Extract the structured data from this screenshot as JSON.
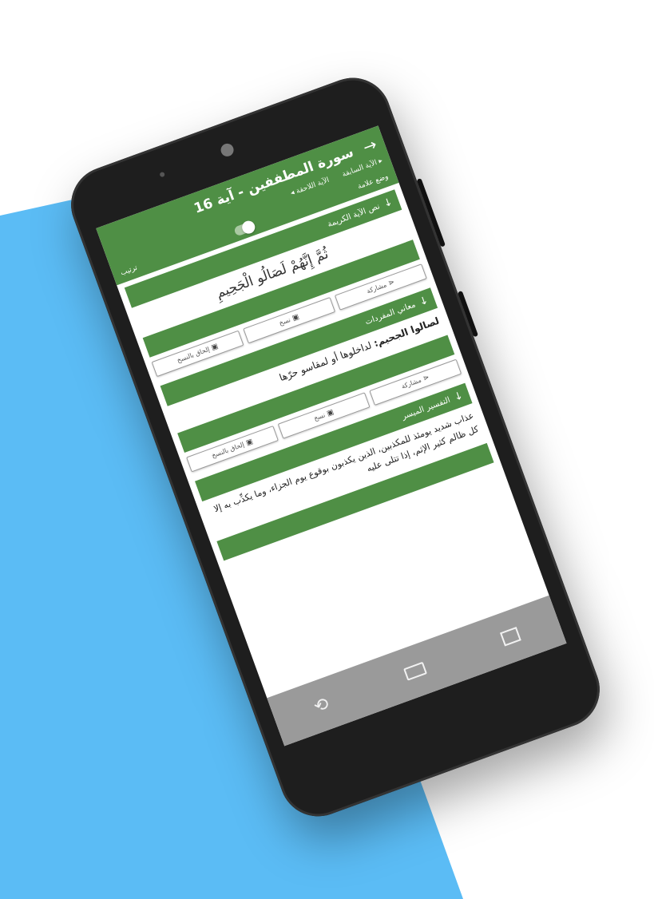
{
  "header": {
    "back_icon": "arrow-right-icon",
    "title": "سورة المطففين - آية 16",
    "prev_ayah": "الآية السابقة",
    "next_ayah": "الآية اللاحقة",
    "bookmark_label": "وضع علامة",
    "sort_label": "ترتيب"
  },
  "sections": {
    "ayah": {
      "heading": "نص الآية الكريمة",
      "text": "ثُمَّ إِنَّهُمْ لَصَالُو الْجَحِيمِ"
    },
    "meanings": {
      "heading": "معاني المفردات",
      "term": "لصالوا الجحيم:",
      "text": "لداخلوها أو لمقاسو حرّها"
    },
    "tafsir": {
      "heading": "التفسير الميسر",
      "text": "عذاب شديد يومئذ للمكذبين، الذين يكذبون بوقوع يوم الجزاء، وما يكذِّب به إلا كل ظالم كثير الإثم، إذا تتلى عليه"
    }
  },
  "buttons": {
    "share": "مشاركة",
    "copy": "نسخ",
    "append_copy": "إلحاق بالنسخ"
  },
  "colors": {
    "accent": "#4f8f45",
    "background_blue": "#5bbcf5",
    "phone_body": "#1e1e1e",
    "nav_bar": "#9a9a9a"
  }
}
